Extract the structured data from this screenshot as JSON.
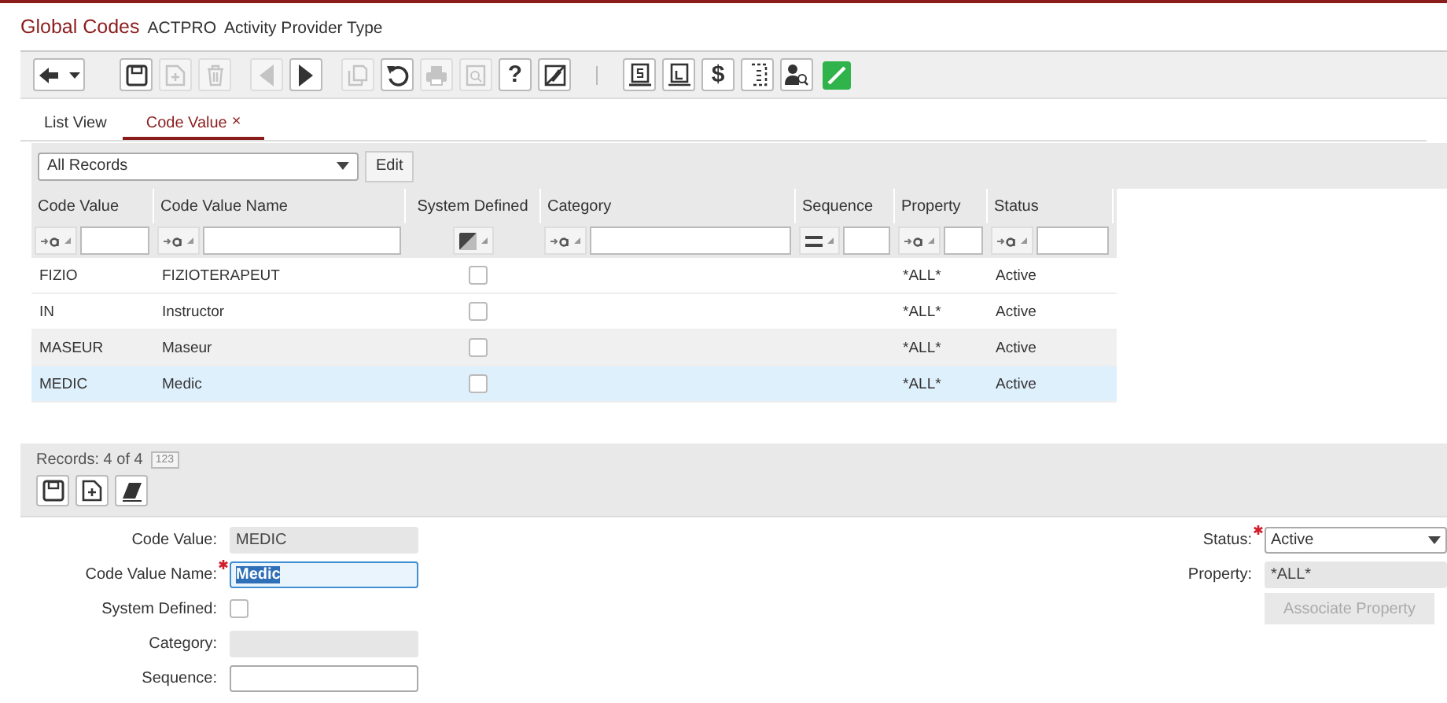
{
  "header": {
    "title": "Global Codes",
    "code": "ACTPRO",
    "subtitle": "Activity Provider Type"
  },
  "toolbar": [
    {
      "kind": "back",
      "disabled": false
    },
    {
      "kind": "save",
      "disabled": false
    },
    {
      "kind": "add",
      "disabled": true
    },
    {
      "kind": "delete",
      "disabled": true
    },
    {
      "kind": "prev",
      "disabled": true
    },
    {
      "kind": "next",
      "disabled": false
    },
    {
      "kind": "copy",
      "disabled": true
    },
    {
      "kind": "undo",
      "disabled": false
    },
    {
      "kind": "print",
      "disabled": true
    },
    {
      "kind": "preview",
      "disabled": true
    },
    {
      "kind": "glyph",
      "glyph": "?",
      "disabled": false
    },
    {
      "kind": "cancel",
      "disabled": false
    },
    {
      "kind": "separator"
    },
    {
      "kind": "doc-dollar",
      "disabled": false
    },
    {
      "kind": "doc",
      "disabled": false
    },
    {
      "kind": "glyph",
      "glyph": "$",
      "disabled": false
    },
    {
      "kind": "doc-dashed",
      "disabled": false
    },
    {
      "kind": "person-search",
      "disabled": false
    },
    {
      "kind": "link"
    }
  ],
  "tabs": [
    {
      "label": "List View",
      "selected": false
    },
    {
      "label": "Code Value",
      "selected": true,
      "close": "×"
    }
  ],
  "view_select": {
    "value": "All Records"
  },
  "edit_button": "Edit",
  "table": {
    "columns": [
      {
        "label": "Code Value",
        "kind": "text"
      },
      {
        "label": "Code Value Name",
        "kind": "text"
      },
      {
        "label": "System Defined",
        "kind": "check"
      },
      {
        "label": "Category",
        "kind": "text"
      },
      {
        "label": "Sequence",
        "kind": "equals"
      },
      {
        "label": "Property",
        "kind": "text"
      },
      {
        "label": "Status",
        "kind": "text"
      }
    ],
    "rows": [
      {
        "code": "FIZIO",
        "name": "FIZIOTERAPEUT",
        "system_defined": false,
        "property": "*ALL*",
        "status": "Active",
        "hovered": false,
        "selected": false
      },
      {
        "code": "IN",
        "name": "Instructor",
        "system_defined": false,
        "property": "*ALL*",
        "status": "Active",
        "hovered": false,
        "selected": false
      },
      {
        "code": "MASEUR",
        "name": "Maseur",
        "system_defined": false,
        "property": "*ALL*",
        "status": "Active",
        "hovered": true,
        "selected": false
      },
      {
        "code": "MEDIC",
        "name": "Medic",
        "system_defined": false,
        "property": "*ALL*",
        "status": "Active",
        "hovered": false,
        "selected": true
      }
    ]
  },
  "records": {
    "label": "Records: 4 of 4",
    "badge": "123"
  },
  "form_toolbar": [
    {
      "kind": "save"
    },
    {
      "kind": "add"
    },
    {
      "kind": "eraser"
    }
  ],
  "form": {
    "left": [
      {
        "label": "Code Value:",
        "kind": "readonly",
        "value": "MEDIC",
        "required": false
      },
      {
        "label": "Code Value Name:",
        "kind": "input",
        "value": "Medic",
        "required": true,
        "text_selected": true
      },
      {
        "label": "System Defined:",
        "kind": "checkbox",
        "checked": false,
        "required": false
      },
      {
        "label": "Category:",
        "kind": "readonly",
        "required": false
      },
      {
        "label": "Sequence:",
        "kind": "input",
        "required": false
      }
    ],
    "right": [
      {
        "label": "Status:",
        "kind": "select",
        "value": "Active",
        "required": true
      },
      {
        "label": "Property:",
        "kind": "readonly",
        "value": "*ALL*",
        "required": false
      },
      {
        "label": "Associate Property",
        "kind": "button",
        "disabled": true
      }
    ]
  }
}
